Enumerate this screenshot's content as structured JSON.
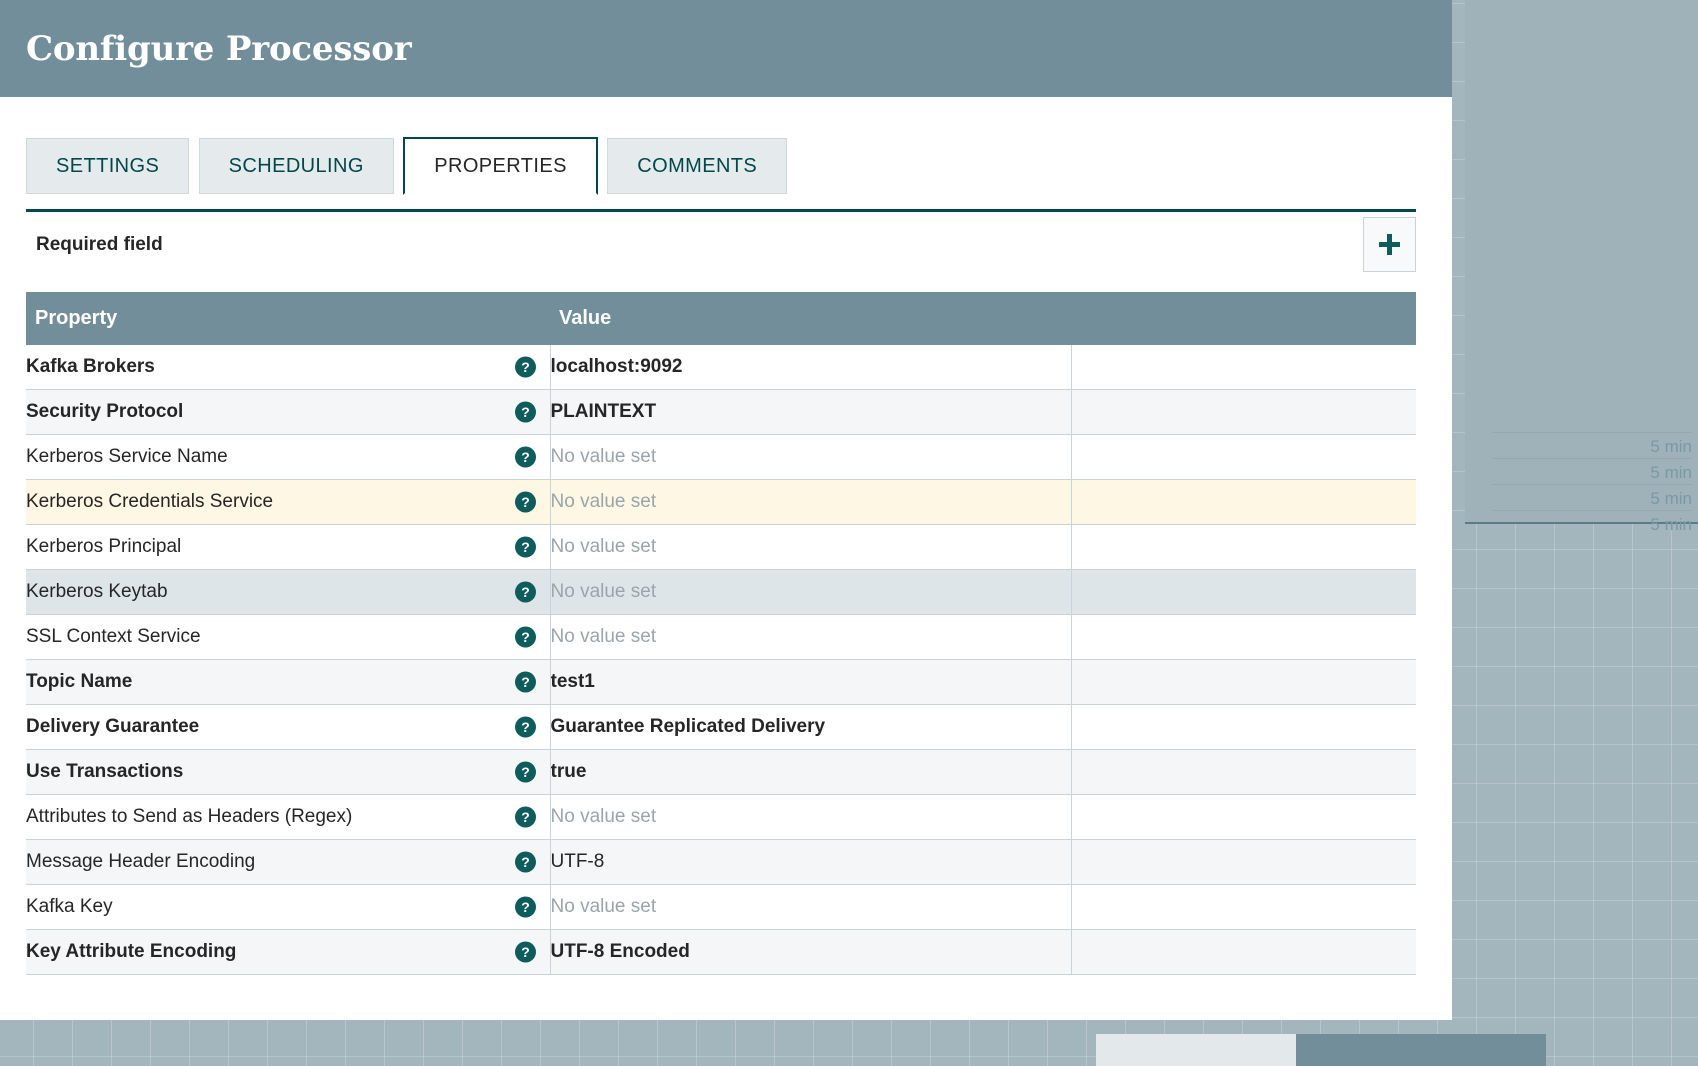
{
  "dialog": {
    "title": "Configure Processor",
    "tabs": [
      {
        "label": "SETTINGS",
        "active": false
      },
      {
        "label": "SCHEDULING",
        "active": false
      },
      {
        "label": "PROPERTIES",
        "active": true
      },
      {
        "label": "COMMENTS",
        "active": false
      }
    ],
    "required_field_label": "Required field",
    "add_button_icon": "plus-icon",
    "table": {
      "columns": [
        "Property",
        "Value"
      ],
      "help_icon": "help-circle-icon",
      "empty_value_text": "No value set",
      "rows": [
        {
          "property": "Kafka Brokers",
          "value": "localhost:9092",
          "required": true,
          "empty": false,
          "style": "plain"
        },
        {
          "property": "Security Protocol",
          "value": "PLAINTEXT",
          "required": true,
          "empty": false,
          "style": "alt"
        },
        {
          "property": "Kerberos Service Name",
          "value": "No value set",
          "required": false,
          "empty": true,
          "style": "plain"
        },
        {
          "property": "Kerberos Credentials Service",
          "value": "No value set",
          "required": false,
          "empty": true,
          "style": "yellow"
        },
        {
          "property": "Kerberos Principal",
          "value": "No value set",
          "required": false,
          "empty": true,
          "style": "plain"
        },
        {
          "property": "Kerberos Keytab",
          "value": "No value set",
          "required": false,
          "empty": true,
          "style": "selected"
        },
        {
          "property": "SSL Context Service",
          "value": "No value set",
          "required": false,
          "empty": true,
          "style": "plain"
        },
        {
          "property": "Topic Name",
          "value": "test1",
          "required": true,
          "empty": false,
          "style": "alt"
        },
        {
          "property": "Delivery Guarantee",
          "value": "Guarantee Replicated Delivery",
          "required": true,
          "empty": false,
          "style": "plain"
        },
        {
          "property": "Use Transactions",
          "value": "true",
          "required": true,
          "empty": false,
          "style": "alt"
        },
        {
          "property": "Attributes to Send as Headers (Regex)",
          "value": "No value set",
          "required": false,
          "empty": true,
          "style": "plain"
        },
        {
          "property": "Message Header Encoding",
          "value": "UTF-8",
          "required": false,
          "empty": false,
          "style": "alt"
        },
        {
          "property": "Kafka Key",
          "value": "No value set",
          "required": false,
          "empty": true,
          "style": "plain"
        },
        {
          "property": "Key Attribute Encoding",
          "value": "UTF-8 Encoded",
          "required": true,
          "empty": false,
          "style": "alt"
        }
      ]
    }
  },
  "background": {
    "panel_rows": [
      "5 min",
      "5 min",
      "5 min",
      "5 min"
    ]
  },
  "colors": {
    "header_bar": "#728e9b",
    "accent_teal": "#004849",
    "tab_inactive_bg": "#e5ebed",
    "row_alt_bg": "#f4f6f8",
    "row_highlight_yellow": "#fdf7e3",
    "row_highlight_selected": "#dde5e8",
    "empty_value_text": "#9aa5ab",
    "canvas_grid": "#a3b5bd"
  }
}
